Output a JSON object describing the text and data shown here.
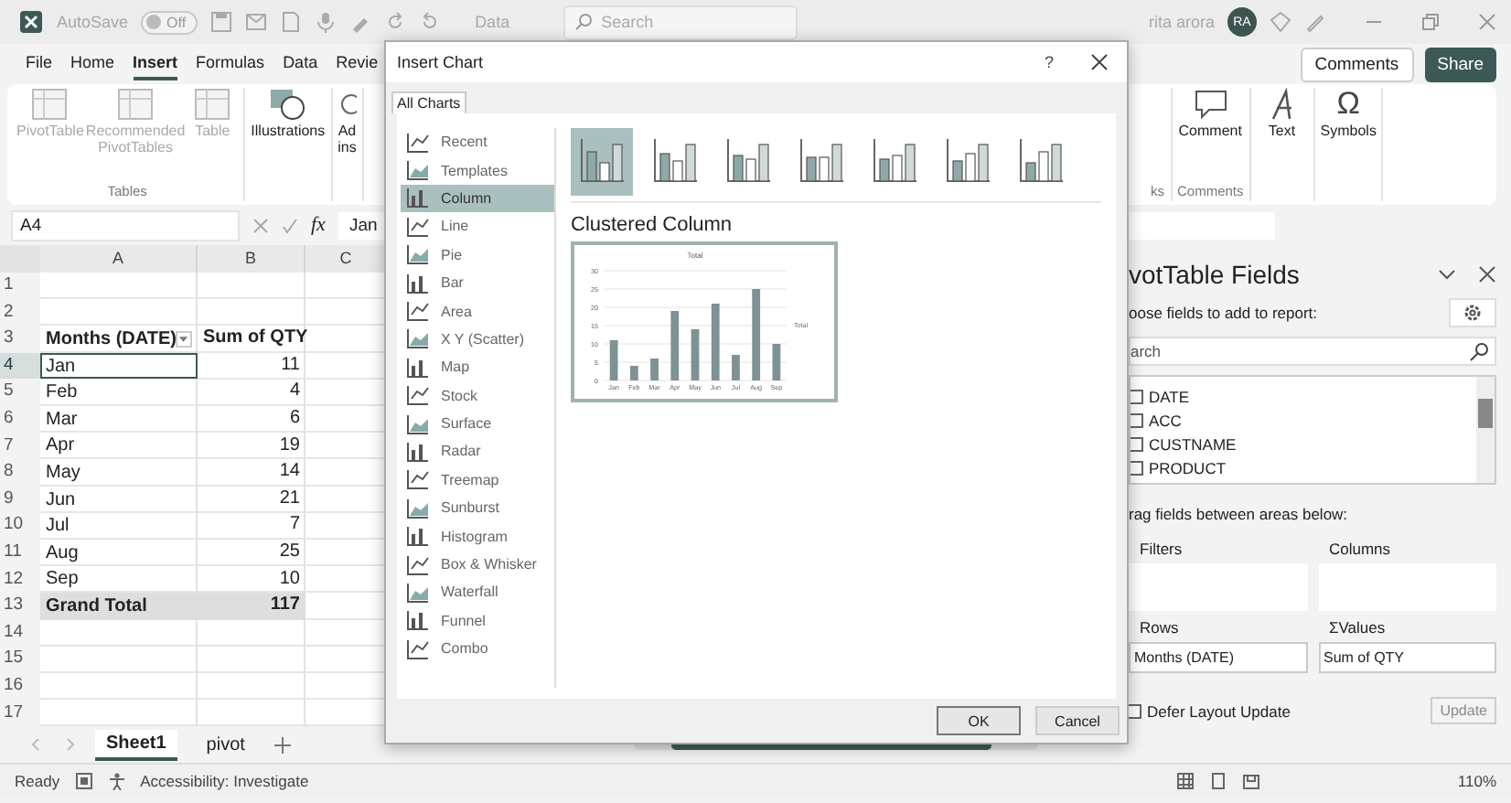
{
  "title_bar": {
    "autosave": {
      "label": "AutoSave",
      "toggle": "Off",
      "on": false
    },
    "menu": "Data",
    "search": {
      "placeholder": "Search"
    },
    "user": "rita arora",
    "avatar": "RA"
  },
  "ribbon_tabs": [
    {
      "label": "File",
      "selected": false
    },
    {
      "label": "Home",
      "selected": false
    },
    {
      "label": "Insert",
      "selected": true
    },
    {
      "label": "Formulas",
      "selected": false
    },
    {
      "label": "Data",
      "selected": false
    },
    {
      "label": "Revie",
      "selected": false
    }
  ],
  "ribbon_actions": [
    {
      "label": "Comments",
      "kind": "outline"
    },
    {
      "label": "Share",
      "kind": "primary"
    }
  ],
  "ribbon_groups": [
    {
      "label": "Tables",
      "buttons": [
        {
          "label": "PivotTable",
          "disabled": true
        },
        {
          "label": "Recommended PivotTables",
          "disabled": true
        },
        {
          "label": "Table",
          "disabled": true
        }
      ]
    },
    {
      "buttons": [
        {
          "label": "Illustrations",
          "disabled": false
        }
      ]
    },
    {
      "buttons": [
        {
          "label": "Ad ins",
          "disabled": false
        }
      ]
    }
  ],
  "ribbon_groups_right": [
    {
      "label": "ks"
    },
    {
      "label": "Comments",
      "buttons": [
        {
          "label": "Comment",
          "disabled": false
        }
      ]
    },
    {
      "buttons": [
        {
          "label": "Text",
          "disabled": false
        }
      ]
    },
    {
      "buttons": [
        {
          "label": "Symbols",
          "glyph": "Ω",
          "disabled": false
        }
      ]
    }
  ],
  "formula_bar": {
    "name_box": "A4",
    "fx": "fx",
    "value": "Jan"
  },
  "sheet": {
    "columns": [
      "A",
      "B",
      "C"
    ],
    "rows": [
      {
        "num": "1",
        "kind": "empty",
        "selected": false
      },
      {
        "num": "2",
        "kind": "empty",
        "selected": false
      },
      {
        "num": "3",
        "kind": "header",
        "a": "Months (DATE)",
        "b": "Sum of QTY",
        "selected": false
      },
      {
        "num": "4",
        "kind": "item",
        "a": "Jan",
        "b": "11",
        "selected": true
      },
      {
        "num": "5",
        "kind": "item",
        "a": "Feb",
        "b": "4",
        "selected": false
      },
      {
        "num": "6",
        "kind": "item",
        "a": "Mar",
        "b": "6",
        "selected": false
      },
      {
        "num": "7",
        "kind": "item",
        "a": "Apr",
        "b": "19",
        "selected": false
      },
      {
        "num": "8",
        "kind": "item",
        "a": "May",
        "b": "14",
        "selected": false
      },
      {
        "num": "9",
        "kind": "item",
        "a": "Jun",
        "b": "21",
        "selected": false
      },
      {
        "num": "10",
        "kind": "item",
        "a": "Jul",
        "b": "7",
        "selected": false
      },
      {
        "num": "11",
        "kind": "item",
        "a": "Aug",
        "b": "25",
        "selected": false
      },
      {
        "num": "12",
        "kind": "item",
        "a": "Sep",
        "b": "10",
        "selected": false
      },
      {
        "num": "13",
        "kind": "total",
        "a": "Grand Total",
        "b": "117",
        "selected": false
      },
      {
        "num": "14",
        "kind": "empty",
        "selected": false
      },
      {
        "num": "15",
        "kind": "empty",
        "selected": false
      },
      {
        "num": "16",
        "kind": "empty",
        "selected": false
      },
      {
        "num": "17",
        "kind": "empty",
        "selected": false
      }
    ]
  },
  "sheet_tabs": [
    {
      "label": "Sheet1",
      "selected": true
    },
    {
      "label": "pivot",
      "selected": false
    }
  ],
  "status_bar": {
    "items": [
      "Ready",
      "Accessibility: Investigate"
    ],
    "zoom": "110%"
  },
  "pivot_pane": {
    "title": "votTable Fields",
    "subtitle": "oose fields to add to report:",
    "search": {
      "placeholder": "arch"
    },
    "fields": [
      {
        "label": "DATE",
        "checked": false
      },
      {
        "label": "ACC",
        "checked": false
      },
      {
        "label": "CUSTNAME",
        "checked": false
      },
      {
        "label": "PRODUCT",
        "checked": false
      }
    ],
    "hint": "rag fields between areas below:",
    "areas": [
      {
        "label": "Filters"
      },
      {
        "label": "Columns"
      },
      {
        "label": "Rows",
        "value": "Months (DATE)"
      },
      {
        "label": "Values",
        "glyph": "Σ",
        "value": "Sum of QTY"
      }
    ],
    "defer": {
      "label": "Defer Layout Update",
      "checked": false
    },
    "update": {
      "label": "Update",
      "disabled": true
    }
  },
  "dialog": {
    "title": "Insert Chart",
    "help": "?",
    "tabs": [
      {
        "label": "All Charts",
        "selected": true
      }
    ],
    "chart_types": [
      {
        "label": "Recent",
        "selected": false
      },
      {
        "label": "Templates",
        "selected": false
      },
      {
        "label": "Column",
        "selected": true
      },
      {
        "label": "Line",
        "selected": false
      },
      {
        "label": "Pie",
        "selected": false
      },
      {
        "label": "Bar",
        "selected": false
      },
      {
        "label": "Area",
        "selected": false
      },
      {
        "label": "X Y (Scatter)",
        "selected": false
      },
      {
        "label": "Map",
        "selected": false
      },
      {
        "label": "Stock",
        "selected": false
      },
      {
        "label": "Surface",
        "selected": false
      },
      {
        "label": "Radar",
        "selected": false
      },
      {
        "label": "Treemap",
        "selected": false
      },
      {
        "label": "Sunburst",
        "selected": false
      },
      {
        "label": "Histogram",
        "selected": false
      },
      {
        "label": "Box & Whisker",
        "selected": false
      },
      {
        "label": "Waterfall",
        "selected": false
      },
      {
        "label": "Funnel",
        "selected": false
      },
      {
        "label": "Combo",
        "selected": false
      }
    ],
    "subtypes": [
      {
        "selected": true
      },
      {
        "selected": false
      },
      {
        "selected": false
      },
      {
        "selected": false
      },
      {
        "selected": false
      },
      {
        "selected": false
      },
      {
        "selected": false
      }
    ],
    "subtype_title": "Clustered Column",
    "preview": {
      "chart_data": {
        "type": "bar",
        "title": "Total",
        "categories": [
          "Jan",
          "Feb",
          "Mar",
          "Apr",
          "May",
          "Jun",
          "Jul",
          "Aug",
          "Sep"
        ],
        "series": [
          {
            "name": "Total",
            "color": "#7d9294",
            "values": [
              11,
              4,
              6,
              19,
              14,
              21,
              7,
              25,
              10
            ]
          }
        ],
        "ylim": [
          0,
          30
        ],
        "yticks": [
          0,
          5,
          10,
          15,
          20,
          25,
          30
        ],
        "grid": true
      }
    },
    "buttons": [
      {
        "label": "OK",
        "kind": "default"
      },
      {
        "label": "Cancel",
        "kind": "normal"
      }
    ]
  }
}
